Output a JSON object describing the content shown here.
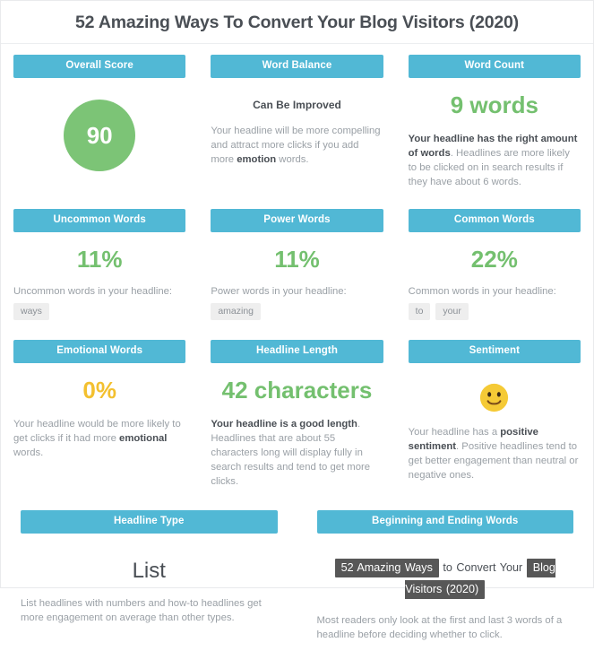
{
  "headline": {
    "title": "52 Amazing Ways To Convert Your Blog Visitors (2020)"
  },
  "cards": {
    "overall_score": {
      "header": "Overall Score",
      "score": "90"
    },
    "word_balance": {
      "header": "Word Balance",
      "verdict": "Can Be Improved",
      "desc_pre": "Your headline will be more compelling and attract more clicks if you add more ",
      "desc_bold": "emotion",
      "desc_post": " words."
    },
    "word_count": {
      "header": "Word Count",
      "value": "9 words",
      "desc_bold": "Your headline has the right amount of words",
      "desc_post": ". Headlines are more likely to be clicked on in search results if they have about 6 words."
    },
    "uncommon_words": {
      "header": "Uncommon Words",
      "value": "11%",
      "label": "Uncommon words in your headline:",
      "words": [
        "ways"
      ]
    },
    "power_words": {
      "header": "Power Words",
      "value": "11%",
      "label": "Power words in your headline:",
      "words": [
        "amazing"
      ]
    },
    "common_words": {
      "header": "Common Words",
      "value": "22%",
      "label": "Common words in your headline:",
      "words": [
        "to",
        "your"
      ]
    },
    "emotional_words": {
      "header": "Emotional Words",
      "value": "0%",
      "desc_pre": "Your headline would be more likely to get clicks if it had more ",
      "desc_bold": "emotional",
      "desc_post": " words."
    },
    "headline_length": {
      "header": "Headline Length",
      "value": "42 characters",
      "desc_bold": "Your headline is a good length",
      "desc_post": ". Headlines that are about 55 characters long will display fully in search results and tend to get more clicks."
    },
    "sentiment": {
      "header": "Sentiment",
      "emoji": "slightly-smiling-face",
      "desc_pre": "Your headline has a ",
      "desc_bold": "positive sentiment",
      "desc_post": ". Positive headlines tend to get better engagement than neutral or negative ones."
    },
    "headline_type": {
      "header": "Headline Type",
      "value": "List",
      "desc": "List headlines with numbers and how-to headlines get more engagement on average than other types."
    },
    "beginning_ending_words": {
      "header": "Beginning and Ending Words",
      "first_words": "52 Amazing Ways",
      "middle_words": "to Convert Your",
      "last_words": "Blog Visitors (2020)",
      "desc": "Most readers only look at the first and last 3 words of a headline before deciding whether to click."
    }
  },
  "colors": {
    "header_teal": "#51b8d5",
    "score_green": "#7cc476",
    "value_green": "#74c06f",
    "value_amber": "#f3c02f",
    "chip_bg": "#eeeeee",
    "highlight_bg": "#575757",
    "text_dark": "#4a4f55",
    "text_muted": "#9aa0a6"
  }
}
